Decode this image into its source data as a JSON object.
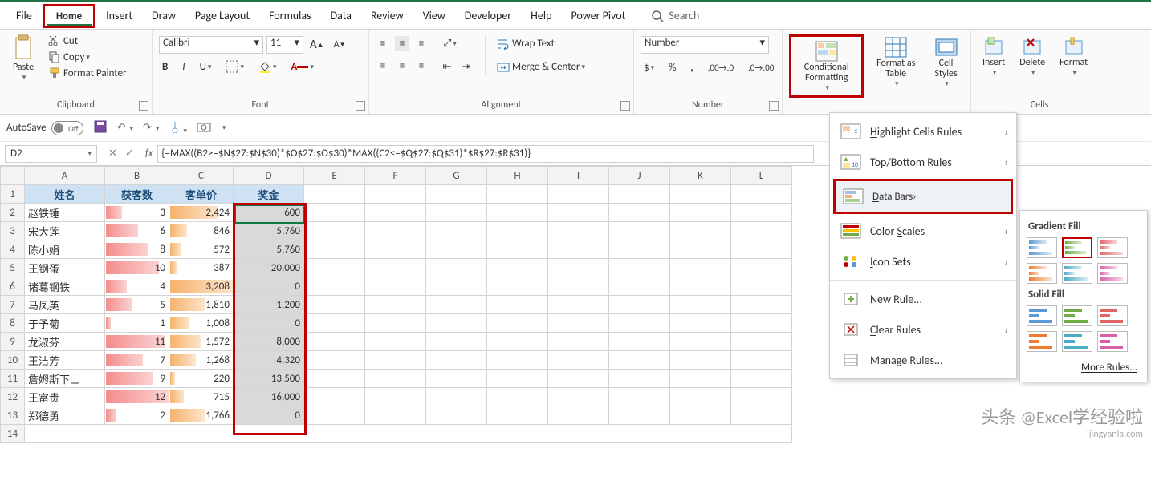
{
  "tabs": {
    "file": "File",
    "home": "Home",
    "insert": "Insert",
    "draw": "Draw",
    "pagelayout": "Page Layout",
    "formulas": "Formulas",
    "data": "Data",
    "review": "Review",
    "view": "View",
    "developer": "Developer",
    "help": "Help",
    "powerpivot": "Power Pivot"
  },
  "search_placeholder": "Search",
  "clipboard": {
    "label": "Clipboard",
    "paste": "Paste",
    "cut": "Cut",
    "copy": "Copy",
    "painter": "Format Painter"
  },
  "font": {
    "label": "Font",
    "name": "Calibri",
    "size": "11"
  },
  "alignment": {
    "label": "Alignment",
    "wrap": "Wrap Text",
    "merge": "Merge & Center"
  },
  "number": {
    "label": "Number",
    "format": "Number"
  },
  "styles": {
    "cf": "Conditional Formatting",
    "fat": "Format as Table",
    "cs": "Cell Styles"
  },
  "cells": {
    "label": "Cells",
    "insert": "Insert",
    "delete": "Delete",
    "format": "Format"
  },
  "cf_menu": {
    "highlight": "Highlight Cells Rules",
    "topbottom": "Top/Bottom Rules",
    "databars": "Data Bars",
    "colorscales": "Color Scales",
    "iconsets": "Icon Sets",
    "newrule": "New Rule...",
    "clear": "Clear Rules",
    "manage": "Manage Rules..."
  },
  "flyout": {
    "gradient": "Gradient Fill",
    "solid": "Solid Fill",
    "more": "More Rules..."
  },
  "qat": {
    "autosave": "AutoSave",
    "off": "Off"
  },
  "namebox": "D2",
  "formula": "{=MAX((B2>=$N$27:$N$30)*$O$27:$O$30)*MAX((C2<=$Q$27:$Q$31)*$R$27:$R$31)}",
  "columns": [
    "A",
    "B",
    "C",
    "D",
    "E",
    "F",
    "G",
    "H",
    "I",
    "J",
    "K",
    "L"
  ],
  "headers": {
    "A": "姓名",
    "B": "获客数",
    "C": "客单价",
    "D": "奖金"
  },
  "rows": [
    {
      "n": "赵铁锤",
      "b": 3,
      "c": "2,424",
      "d": "600",
      "bb": 25,
      "cb": 76
    },
    {
      "n": "宋大莲",
      "b": 6,
      "c": "846",
      "d": "5,760",
      "bb": 50,
      "cb": 26
    },
    {
      "n": "陈小娟",
      "b": 8,
      "c": "572",
      "d": "5,760",
      "bb": 67,
      "cb": 18
    },
    {
      "n": "王钢蛋",
      "b": 10,
      "c": "387",
      "d": "20,000",
      "bb": 83,
      "cb": 12
    },
    {
      "n": "诸葛钢铁",
      "b": 4,
      "c": "3,208",
      "d": "0",
      "bb": 33,
      "cb": 100
    },
    {
      "n": "马凤英",
      "b": 5,
      "c": "1,810",
      "d": "1,200",
      "bb": 42,
      "cb": 56
    },
    {
      "n": "于予菊",
      "b": 1,
      "c": "1,008",
      "d": "0",
      "bb": 8,
      "cb": 31
    },
    {
      "n": "龙淑芬",
      "b": 11,
      "c": "1,572",
      "d": "8,000",
      "bb": 92,
      "cb": 49
    },
    {
      "n": "王洁芳",
      "b": 7,
      "c": "1,268",
      "d": "4,320",
      "bb": 58,
      "cb": 40
    },
    {
      "n": "詹姆斯下士",
      "b": 9,
      "c": "220",
      "d": "13,500",
      "bb": 75,
      "cb": 7
    },
    {
      "n": "王富贵",
      "b": 12,
      "c": "715",
      "d": "16,000",
      "bb": 100,
      "cb": 22
    },
    {
      "n": "郑德勇",
      "b": 2,
      "c": "1,766",
      "d": "0",
      "bb": 17,
      "cb": 55
    }
  ],
  "watermark": {
    "main": "头条 @Excel学经验啦",
    "sub": "jingyanla.com"
  }
}
